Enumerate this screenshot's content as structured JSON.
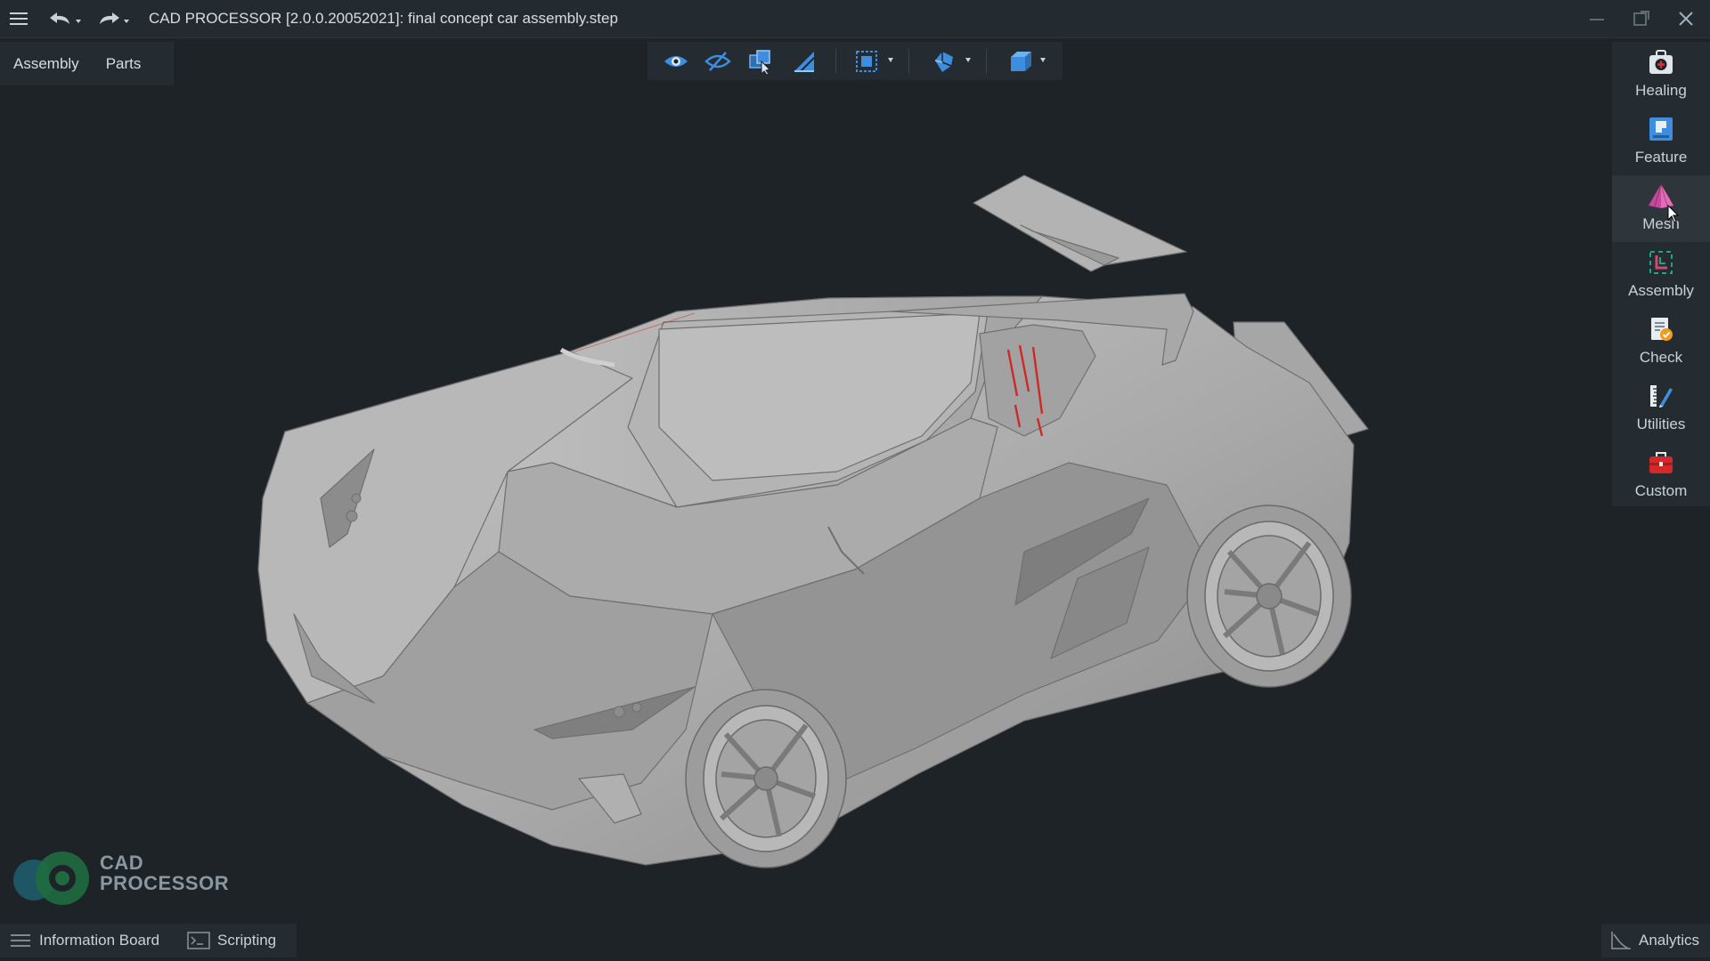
{
  "window": {
    "title": "CAD PROCESSOR [2.0.0.20052021]:  final concept car assembly.step"
  },
  "left_tabs": [
    {
      "label": "Assembly"
    },
    {
      "label": "Parts"
    }
  ],
  "toolbar": {
    "tools": [
      {
        "icon": "eye-icon"
      },
      {
        "icon": "hide-icon"
      },
      {
        "icon": "select-parts-icon"
      },
      {
        "icon": "measure-icon"
      },
      {
        "icon": "selection-mode-icon"
      },
      {
        "icon": "cube-view-icon"
      },
      {
        "icon": "view-orientation-icon"
      }
    ]
  },
  "right_panel": {
    "items": [
      {
        "label": "Healing",
        "icon": "healing-kit-icon"
      },
      {
        "label": "Feature",
        "icon": "feature-icon"
      },
      {
        "label": "Mesh",
        "icon": "mesh-pyramid-icon",
        "active": true
      },
      {
        "label": "Assembly",
        "icon": "assembly-icon"
      },
      {
        "label": "Check",
        "icon": "check-document-icon"
      },
      {
        "label": "Utilities",
        "icon": "ruler-pencil-icon"
      },
      {
        "label": "Custom",
        "icon": "toolbox-icon"
      }
    ]
  },
  "logo": {
    "line1": "CAD",
    "line2": "PROCESSOR"
  },
  "bottom_bar": {
    "information_board": "Information Board",
    "scripting": "Scripting",
    "analytics": "Analytics"
  },
  "colors": {
    "background": "#1d2327",
    "panel": "#252c31",
    "accent": "#4a90d9",
    "model_highlight": "#d02828"
  }
}
